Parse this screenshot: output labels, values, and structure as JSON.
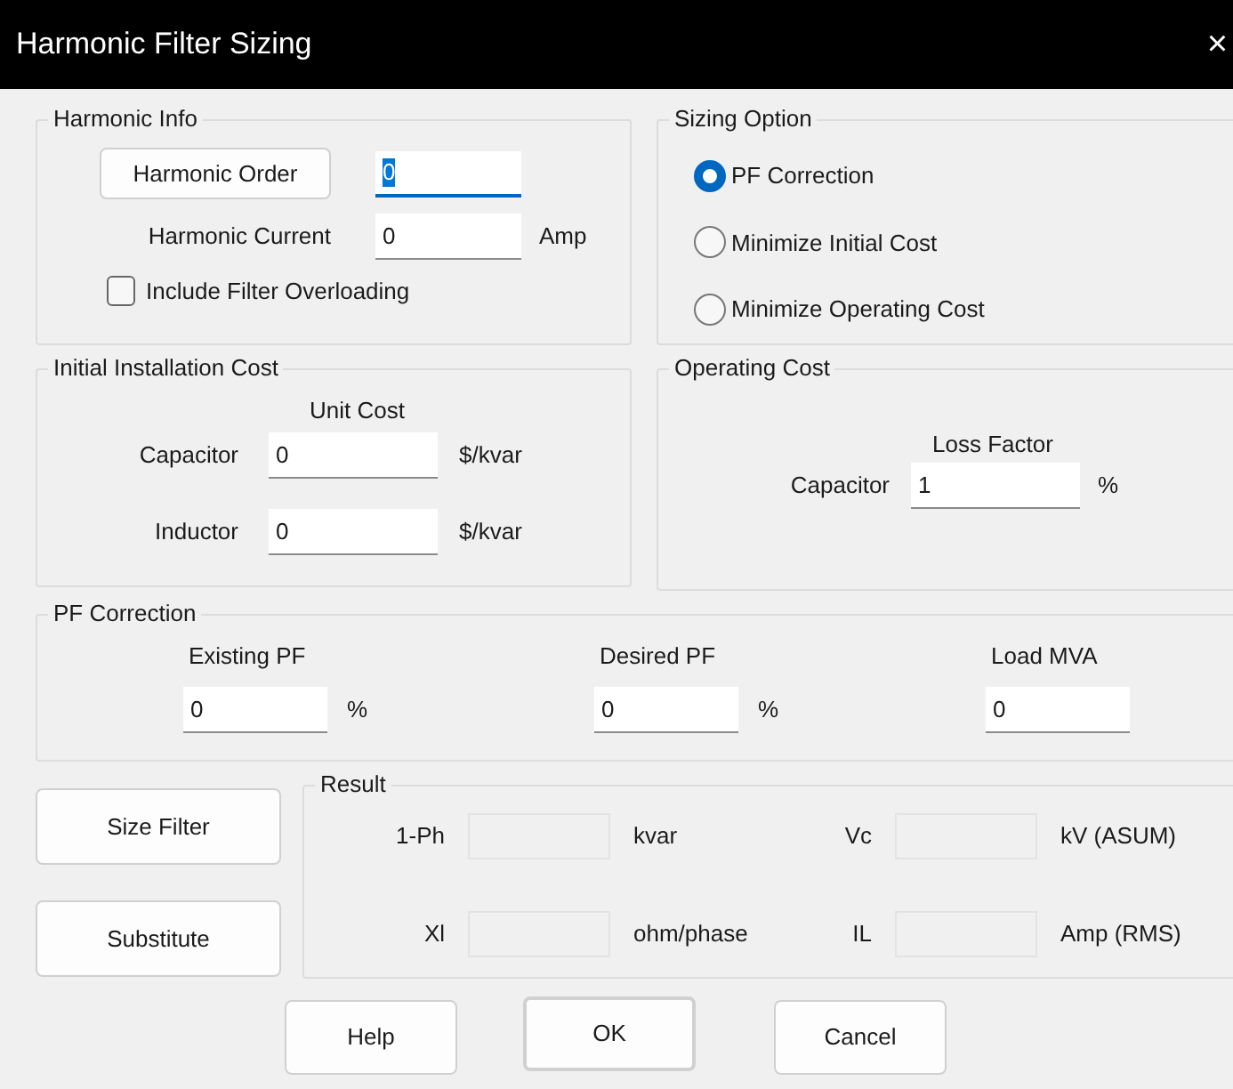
{
  "window": {
    "title": "Harmonic Filter Sizing",
    "close": "×"
  },
  "harmonic_info": {
    "title": "Harmonic Info",
    "order_button": "Harmonic Order",
    "order_field": {
      "value": "0",
      "focused": true,
      "disabled": false
    },
    "current_label": "Harmonic Current",
    "current_field": {
      "value": "0",
      "focused": false,
      "disabled": false
    },
    "current_unit": "Amp",
    "overload": {
      "label": "Include Filter Overloading",
      "checked": false
    }
  },
  "sizing_option": {
    "title": "Sizing Option",
    "options": [
      {
        "label": "PF Correction",
        "selected": true
      },
      {
        "label": "Minimize Initial Cost",
        "selected": false
      },
      {
        "label": "Minimize Operating Cost",
        "selected": false
      }
    ]
  },
  "initial_cost": {
    "title": "Initial Installation Cost",
    "column_label": "Unit Cost",
    "rows": [
      {
        "label": "Capacitor",
        "field": {
          "value": "0",
          "focused": false,
          "disabled": false
        },
        "unit": "$/kvar"
      },
      {
        "label": "Inductor",
        "field": {
          "value": "0",
          "focused": false,
          "disabled": false
        },
        "unit": "$/kvar"
      }
    ]
  },
  "operating_cost": {
    "title": "Operating Cost",
    "column_label": "Loss Factor",
    "rows": [
      {
        "label": "Capacitor",
        "field": {
          "value": "1",
          "focused": false,
          "disabled": false
        },
        "unit": "%"
      }
    ]
  },
  "pf_correction": {
    "title": "PF Correction",
    "items": [
      {
        "label": "Existing PF",
        "field": {
          "value": "0",
          "focused": false,
          "disabled": false
        },
        "unit": "%"
      },
      {
        "label": "Desired PF",
        "field": {
          "value": "0",
          "focused": false,
          "disabled": false
        },
        "unit": "%"
      },
      {
        "label": "Load MVA",
        "field": {
          "value": "0",
          "focused": false,
          "disabled": false
        }
      }
    ]
  },
  "side_buttons": [
    "Size Filter",
    "Substitute"
  ],
  "result": {
    "title": "Result",
    "items": [
      {
        "label": "1-Ph",
        "field": {
          "disabled": true
        },
        "unit": "kvar"
      },
      {
        "label": "Vc",
        "field": {
          "disabled": true
        },
        "unit": "kV (ASUM)"
      },
      {
        "label": "Xl",
        "field": {
          "disabled": true
        },
        "unit": "ohm/phase"
      },
      {
        "label": "IL",
        "field": {
          "disabled": true
        },
        "unit": "Amp (RMS)"
      }
    ]
  },
  "buttons": [
    {
      "label": "Help",
      "default": false
    },
    {
      "label": "OK",
      "default": true
    },
    {
      "label": "Cancel",
      "default": false
    }
  ]
}
